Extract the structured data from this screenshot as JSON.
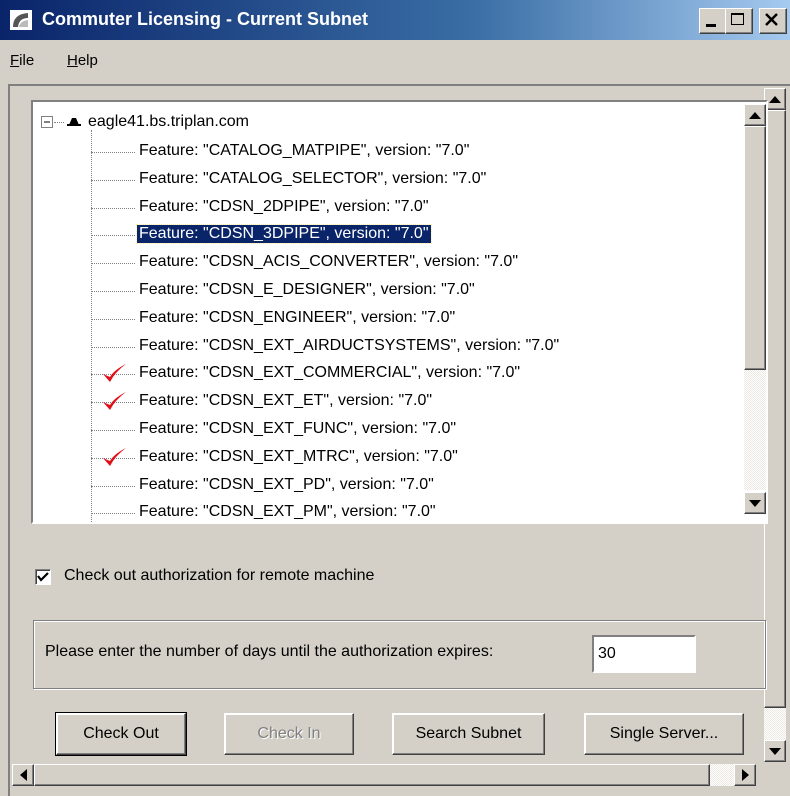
{
  "window": {
    "title": "Commuter Licensing - Current Subnet"
  },
  "menu": [
    {
      "label": "File",
      "mnemonic": "F",
      "rest": "ile"
    },
    {
      "label": "Help",
      "mnemonic": "H",
      "rest": "elp"
    }
  ],
  "tree": {
    "server": "eagle41.bs.triplan.com",
    "features": [
      {
        "text": "Feature: \"CATALOG_MATPIPE\", version: \"7.0\"",
        "checked": false,
        "selected": false
      },
      {
        "text": "Feature: \"CATALOG_SELECTOR\", version: \"7.0\"",
        "checked": false,
        "selected": false
      },
      {
        "text": "Feature: \"CDSN_2DPIPE\", version: \"7.0\"",
        "checked": false,
        "selected": false
      },
      {
        "text": "Feature: \"CDSN_3DPIPE\", version: \"7.0\"",
        "checked": false,
        "selected": true
      },
      {
        "text": "Feature: \"CDSN_ACIS_CONVERTER\", version: \"7.0\"",
        "checked": false,
        "selected": false
      },
      {
        "text": "Feature: \"CDSN_E_DESIGNER\", version: \"7.0\"",
        "checked": false,
        "selected": false
      },
      {
        "text": "Feature: \"CDSN_ENGINEER\", version: \"7.0\"",
        "checked": false,
        "selected": false
      },
      {
        "text": "Feature: \"CDSN_EXT_AIRDUCTSYSTEMS\", version: \"7.0\"",
        "checked": false,
        "selected": false
      },
      {
        "text": "Feature: \"CDSN_EXT_COMMERCIAL\", version: \"7.0\"",
        "checked": true,
        "selected": false
      },
      {
        "text": "Feature: \"CDSN_EXT_ET\", version: \"7.0\"",
        "checked": true,
        "selected": false
      },
      {
        "text": "Feature: \"CDSN_EXT_FUNC\", version: \"7.0\"",
        "checked": false,
        "selected": false
      },
      {
        "text": "Feature: \"CDSN_EXT_MTRC\", version: \"7.0\"",
        "checked": true,
        "selected": false
      },
      {
        "text": "Feature: \"CDSN_EXT_PD\", version: \"7.0\"",
        "checked": false,
        "selected": false
      },
      {
        "text": "Feature: \"CDSN_EXT_PM\", version: \"7.0\"",
        "checked": false,
        "selected": false
      }
    ]
  },
  "remote_checkbox": {
    "label": "Check out authorization for remote machine",
    "checked": true
  },
  "days": {
    "label": "Please enter the number of days until the authorization expires:",
    "value": "30"
  },
  "buttons": {
    "check_out": "Check Out",
    "check_in": "Check In",
    "search_subnet": "Search Subnet",
    "single_server": "Single Server..."
  },
  "colors": {
    "selection": "#0a246a",
    "checkmark": "#e0101a",
    "face": "#d4d0c8"
  },
  "icons": {
    "app": "commuter-app-icon",
    "server": "server-icon",
    "check": "checkmark-icon"
  }
}
